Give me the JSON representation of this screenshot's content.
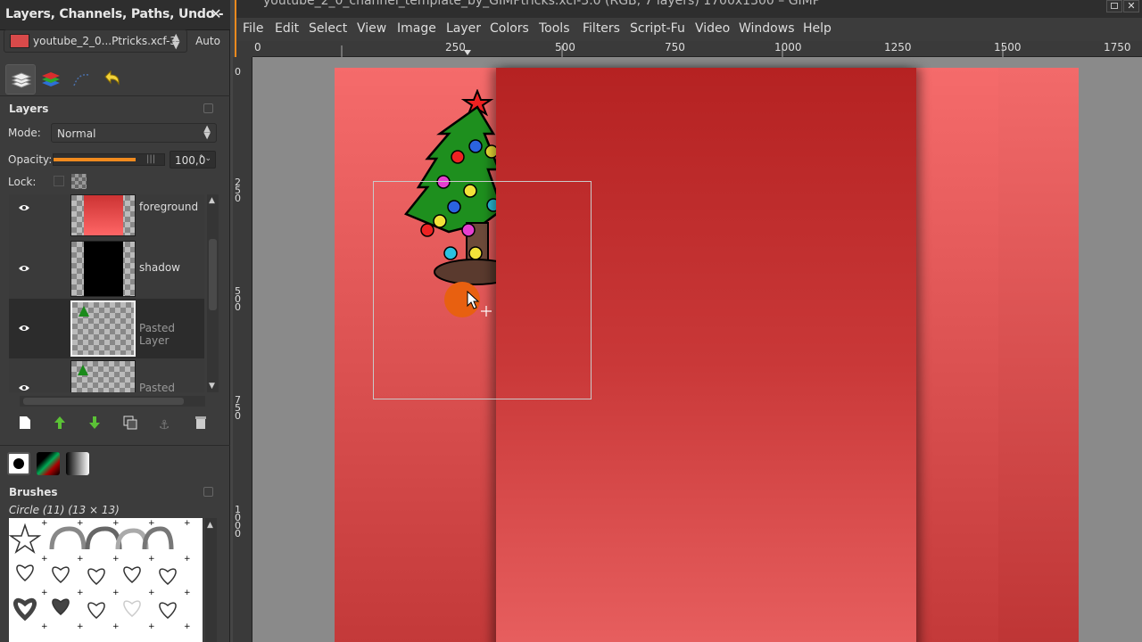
{
  "dock": {
    "title": "Layers, Channels, Paths, Undo - ...",
    "close_icon": "close-icon",
    "image_name": "youtube_2_0...Ptricks.xcf-3",
    "auto_label": "Auto",
    "tabs": [
      "layers-tab-icon",
      "channels-tab-icon",
      "paths-tab-icon",
      "undo-tab-icon"
    ]
  },
  "layers_panel": {
    "title": "Layers",
    "mode_label": "Mode:",
    "mode_value": "Normal",
    "opacity_label": "Opacity:",
    "opacity_value": "100,0",
    "opacity_fraction": 1.0,
    "lock_label": "Lock:",
    "layers": [
      {
        "name": "foreground",
        "visible": true,
        "selected": false
      },
      {
        "name": "shadow",
        "visible": true,
        "selected": false
      },
      {
        "name": "Pasted Layer",
        "visible": true,
        "selected": true
      },
      {
        "name": "Pasted Layer",
        "visible": true,
        "selected": false
      }
    ]
  },
  "brushes_panel": {
    "title": "Brushes",
    "current": "Circle (11) (13 × 13)"
  },
  "window": {
    "title": "youtube_2_0_channel_template_by_GIMPtricks.xcf-3.0 (RGB, 7 layers) 1700x1300 – GIMP"
  },
  "menu": [
    "File",
    "Edit",
    "Select",
    "View",
    "Image",
    "Layer",
    "Colors",
    "Tools",
    "Filters",
    "Script-Fu",
    "Video",
    "Windows",
    "Help"
  ],
  "hruler": [
    "0",
    "250",
    "500",
    "750",
    "1000",
    "1250",
    "1500",
    "1750"
  ],
  "vruler": [
    "0",
    "250",
    "500",
    "750",
    "1000"
  ],
  "colors": {
    "accent": "#f08a1e",
    "banner": "#c93838",
    "canvas_bg": "#8a8a8a"
  }
}
